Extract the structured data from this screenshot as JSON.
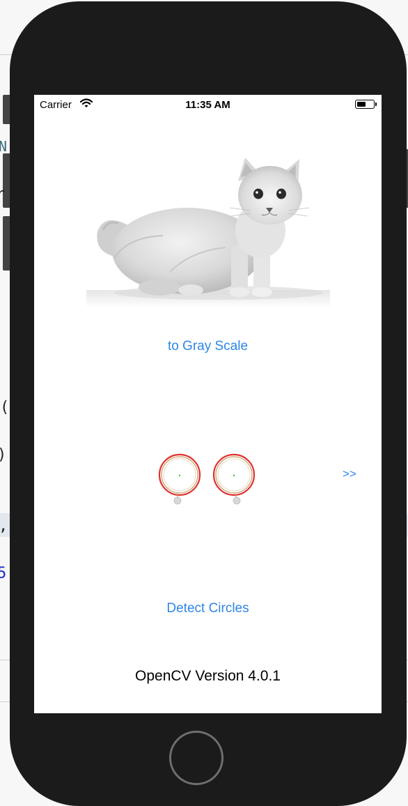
{
  "status_bar": {
    "carrier": "Carrier",
    "time": "11:35 AM"
  },
  "background_editor": {
    "fragments": [
      "N",
      "r",
      "(",
      ")",
      ",",
      "5"
    ]
  },
  "app": {
    "gray_button_label": "to Gray Scale",
    "next_button_label": ">>",
    "detect_button_label": "Detect Circles",
    "version_text": "OpenCV Version 4.0.1"
  },
  "colors": {
    "phone_body": "#1b1b1b",
    "ios_blue": "#2d86e5",
    "circle_outline": "#e0312d"
  },
  "icons": [
    "wifi-icon",
    "battery-icon",
    "home-button"
  ]
}
